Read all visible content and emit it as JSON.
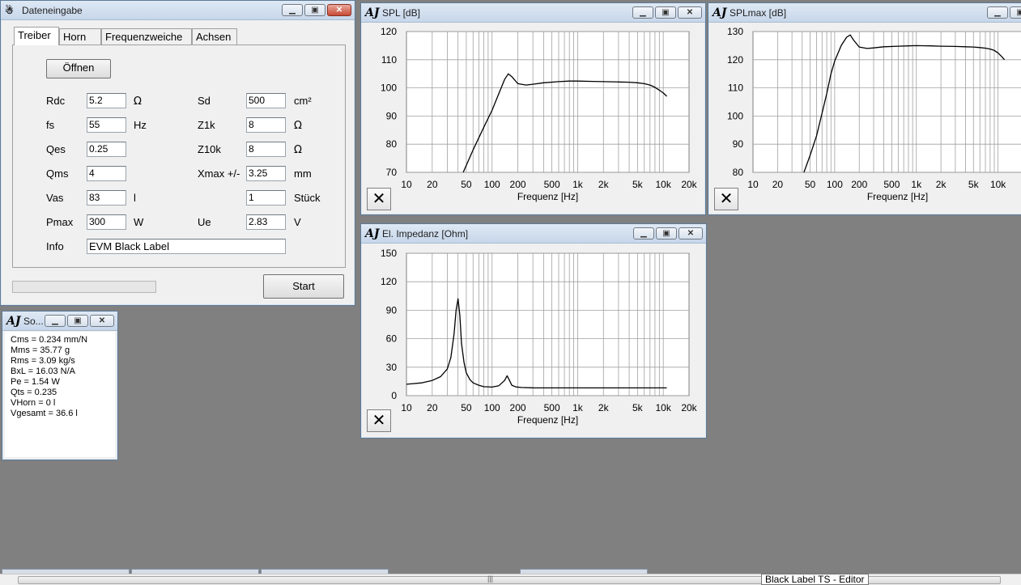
{
  "dateneingabe": {
    "title": "Dateneingabe",
    "tabs": [
      "Treiber",
      "Horn",
      "Frequenzweiche",
      "Achsen"
    ],
    "open_label": "Öffnen",
    "start_label": "Start",
    "fields": {
      "rdc": {
        "label": "Rdc",
        "value": "5.2",
        "unit": "Ω"
      },
      "fs": {
        "label": "fs",
        "value": "55",
        "unit": "Hz"
      },
      "qes": {
        "label": "Qes",
        "value": "0.25"
      },
      "qms": {
        "label": "Qms",
        "value": "4"
      },
      "vas": {
        "label": "Vas",
        "value": "83",
        "unit": "l"
      },
      "pmax": {
        "label": "Pmax",
        "value": "300",
        "unit": "W"
      },
      "sd": {
        "label": "Sd",
        "value": "500",
        "unit": "cm²"
      },
      "z1k": {
        "label": "Z1k",
        "value": "8",
        "unit": "Ω"
      },
      "z10k": {
        "label": "Z10k",
        "value": "8",
        "unit": "Ω"
      },
      "xmax": {
        "label": "Xmax +/-",
        "value": "3.25",
        "unit": "mm"
      },
      "count": {
        "value": "1",
        "unit": "Stück"
      },
      "ue": {
        "label": "Ue",
        "value": "2.83",
        "unit": "V"
      },
      "info": {
        "label": "Info",
        "value": "EVM Black Label"
      }
    }
  },
  "results": {
    "title": "So...",
    "lines": [
      "Cms = 0.234 mm/N",
      "Mms = 35.77 g",
      "Rms = 3.09 kg/s",
      "BxL = 16.03 N/A",
      "Pe = 1.54 W",
      "Qts = 0.235",
      "VHorn = 0 l",
      "Vgesamt = 36.6 l"
    ]
  },
  "window_icon_text": "AJ",
  "chart_data": [
    {
      "type": "line",
      "window_title": "SPL [dB]",
      "xlabel": "Frequenz [Hz]",
      "xscale": "log",
      "xlim": [
        10,
        20000
      ],
      "ylim": [
        70,
        120
      ],
      "yticks": [
        70,
        80,
        90,
        100,
        110,
        120
      ],
      "xtick_labels": [
        "10",
        "20",
        "50",
        "100",
        "200",
        "500",
        "1k",
        "2k",
        "5k",
        "10k",
        "20k"
      ],
      "grid": true,
      "series": [
        {
          "x": [
            46,
            60,
            80,
            100,
            120,
            140,
            155,
            170,
            200,
            250,
            300,
            400,
            600,
            800,
            1000,
            1500,
            2000,
            3000,
            4000,
            5000,
            6000,
            7000,
            8000,
            9000,
            10000,
            11000
          ],
          "y": [
            70,
            78,
            86,
            92,
            98,
            103,
            105,
            104,
            101.5,
            101,
            101.3,
            101.8,
            102.2,
            102.4,
            102.4,
            102.3,
            102.2,
            102.1,
            102,
            101.8,
            101.5,
            101,
            100.2,
            99.2,
            98.2,
            97
          ]
        }
      ]
    },
    {
      "type": "line",
      "window_title": "SPLmax [dB]",
      "xlabel": "Frequenz [Hz]",
      "xscale": "log",
      "xlim": [
        10,
        20000
      ],
      "ylim": [
        80,
        130
      ],
      "yticks": [
        80,
        90,
        100,
        110,
        120,
        130
      ],
      "xtick_labels": [
        "10",
        "20",
        "50",
        "100",
        "200",
        "500",
        "1k",
        "2k",
        "5k",
        "10k"
      ],
      "grid": true,
      "series": [
        {
          "x": [
            42,
            50,
            60,
            70,
            80,
            90,
            100,
            120,
            140,
            155,
            170,
            200,
            250,
            300,
            400,
            600,
            800,
            1000,
            1500,
            2000,
            3000,
            4000,
            5000,
            6000,
            7000,
            8000,
            9000,
            10000,
            11000,
            12000
          ],
          "y": [
            80,
            86,
            93,
            101,
            108,
            115,
            119.5,
            125,
            128,
            128.8,
            127,
            124.5,
            124,
            124.2,
            124.6,
            124.8,
            124.9,
            125,
            124.9,
            124.8,
            124.7,
            124.6,
            124.5,
            124.3,
            124.1,
            123.8,
            123.3,
            122.4,
            121.2,
            120
          ]
        }
      ]
    },
    {
      "type": "line",
      "window_title": "El. Impedanz [Ohm]",
      "xlabel": "Frequenz [Hz]",
      "xscale": "log",
      "xlim": [
        10,
        20000
      ],
      "ylim": [
        0,
        150
      ],
      "yticks": [
        0,
        30,
        60,
        90,
        120,
        150
      ],
      "xtick_labels": [
        "10",
        "20",
        "50",
        "100",
        "200",
        "500",
        "1k",
        "2k",
        "5k",
        "10k",
        "20k"
      ],
      "grid": true,
      "series": [
        {
          "x": [
            10,
            15,
            20,
            25,
            30,
            33,
            36,
            38,
            40,
            42,
            44,
            47,
            50,
            55,
            60,
            70,
            80,
            100,
            120,
            140,
            150,
            160,
            170,
            190,
            220,
            300,
            500,
            1000,
            2000,
            5000,
            10000,
            11000
          ],
          "y": [
            12,
            13.5,
            16,
            20,
            28,
            40,
            65,
            90,
            102,
            85,
            55,
            35,
            24,
            17,
            13.5,
            11,
            9.5,
            9,
            10.5,
            16,
            21,
            16,
            11,
            9.2,
            8.6,
            8.3,
            8.2,
            8.2,
            8.2,
            8.2,
            8.2,
            8.2
          ]
        }
      ]
    }
  ],
  "statusbar": {
    "tooltip": "Black Label TS - Editor",
    "scroll_grip": "|||"
  }
}
